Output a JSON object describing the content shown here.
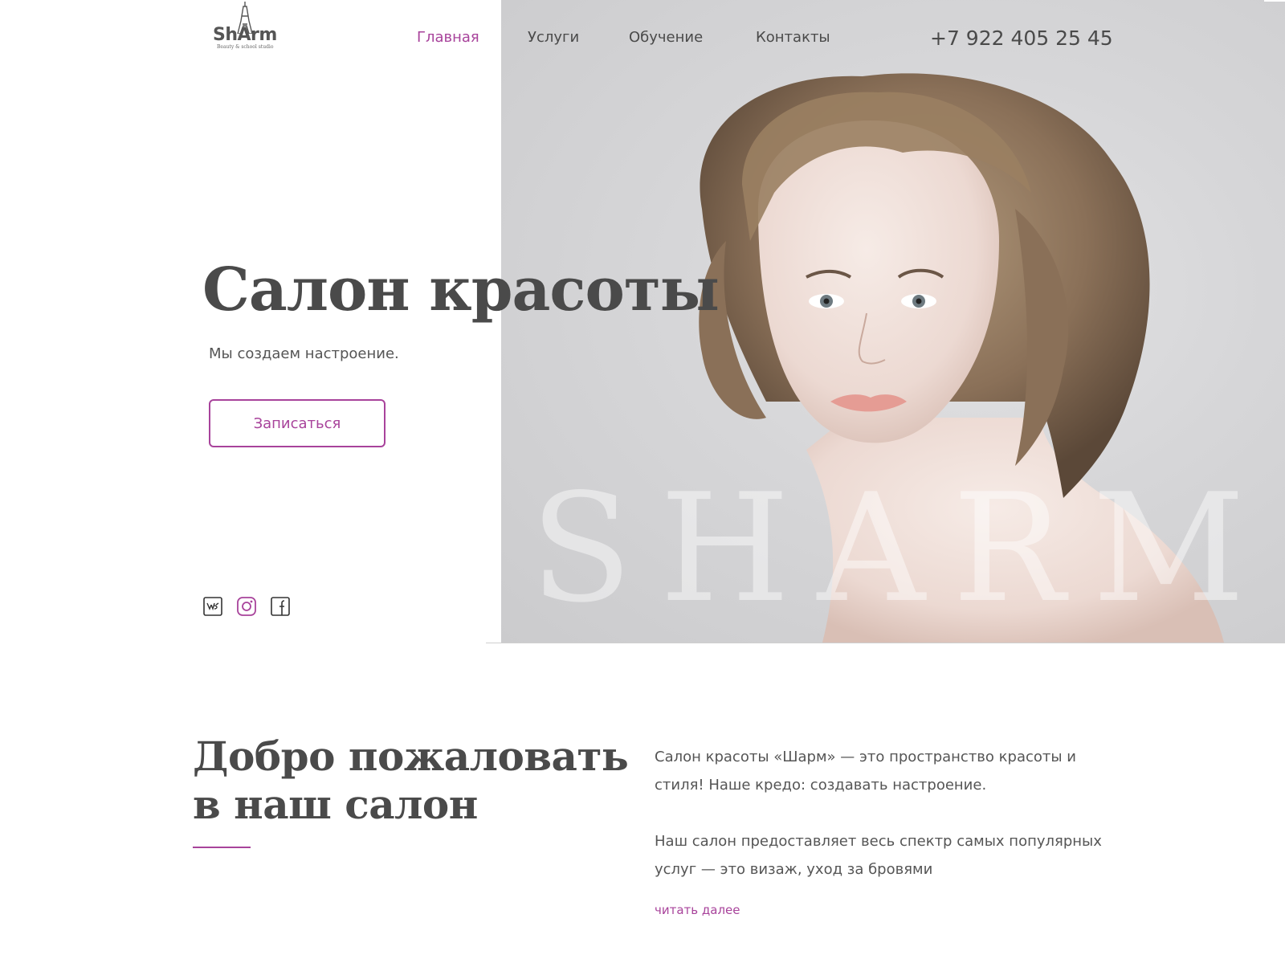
{
  "brand": {
    "logo_text": "ShArm",
    "logo_sub": "Beauty & school studio"
  },
  "nav": {
    "items": [
      {
        "label": "Главная",
        "active": true
      },
      {
        "label": "Услуги",
        "active": false
      },
      {
        "label": "Обучение",
        "active": false
      },
      {
        "label": "Контакты",
        "active": false
      }
    ],
    "phone": "+7 922 405 25 45"
  },
  "hero": {
    "title": "Салон красоты",
    "subtitle": "Мы создаем настроение.",
    "cta_label": "Записаться",
    "watermark": "SHARM",
    "social": [
      "vk-icon",
      "instagram-icon",
      "facebook-icon"
    ]
  },
  "welcome": {
    "title_line1": "Добро пожаловать",
    "title_line2": "в наш салон",
    "para1": "Салон красоты «Шарм» — это пространство красоты и стиля! Наше кредо: создавать настроение.",
    "para2": "Наш салон предоставляет весь спектр самых популярных услуг — это визаж, уход за бровями",
    "read_more": "читать далее"
  },
  "colors": {
    "accent": "#a8439b",
    "text": "#4a4a4a",
    "photo_bg": "#d6d6d8"
  }
}
